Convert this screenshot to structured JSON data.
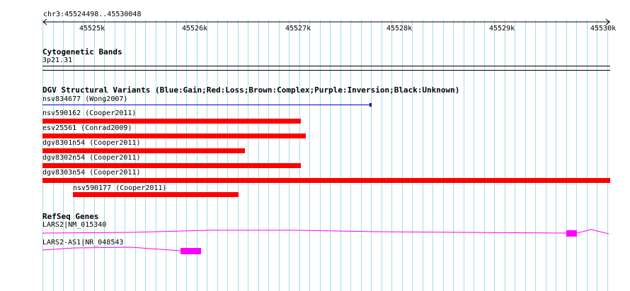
{
  "ruler": {
    "location": "chr3:45524498..45530048",
    "ticks": [
      "45525k",
      "45526k",
      "45527k",
      "45528k",
      "45529k",
      "45530k"
    ]
  },
  "tracks": {
    "cytobands": {
      "title": "Cytogenetic Bands",
      "band_label": "3p21.31"
    },
    "dgv": {
      "title": "DGV Structural Variants (Blue:Gain;Red:Loss;Brown:Complex;Purple:Inversion;Black:Unknown)",
      "features": [
        {
          "label": "nsv834677 (Wong2007)",
          "color": "#0000cc",
          "type": "gain"
        },
        {
          "label": "nsv590162 (Cooper2011)",
          "color": "#ff0000",
          "type": "loss"
        },
        {
          "label": "esv25561 (Conrad2009)",
          "color": "#ff0000",
          "type": "loss"
        },
        {
          "label": "dgv8301n54 (Cooper2011)",
          "color": "#ff0000",
          "type": "loss"
        },
        {
          "label": "dgv8302n54 (Cooper2011)",
          "color": "#ff0000",
          "type": "loss"
        },
        {
          "label": "dgv8303n54 (Cooper2011)",
          "color": "#ff0000",
          "type": "loss"
        },
        {
          "label": "nsv590177 (Cooper2011)",
          "color": "#ff0000",
          "type": "loss"
        }
      ]
    },
    "refseq": {
      "title": "RefSeq Genes",
      "genes": [
        {
          "label": "LARS2|NM_015340",
          "color": "#ff00ff"
        },
        {
          "label": "LARS2-AS1|NR_048543",
          "color": "#ff00ff"
        }
      ]
    }
  }
}
